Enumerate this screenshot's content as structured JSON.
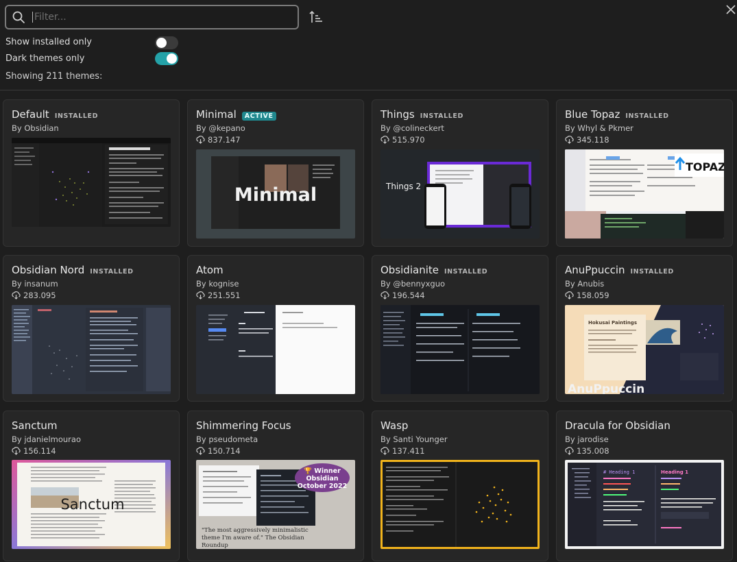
{
  "search": {
    "placeholder": "Filter..."
  },
  "settings": {
    "installed_only": {
      "label": "Show installed only",
      "on": false
    },
    "dark_only": {
      "label": "Dark themes only",
      "on": true
    }
  },
  "count_text": "Showing 211 themes:",
  "themes": [
    {
      "name": "Default",
      "badge": "INSTALLED",
      "author": "By Obsidian",
      "downloads": "",
      "preview_text": "",
      "preview_caption": ""
    },
    {
      "name": "Minimal",
      "badge": "ACTIVE",
      "author": "By @kepano",
      "downloads": "837.147",
      "preview_text": "Minimal",
      "preview_caption": ""
    },
    {
      "name": "Things",
      "badge": "INSTALLED",
      "author": "By @colineckert",
      "downloads": "515.970",
      "preview_text": "Things 2",
      "preview_caption": ""
    },
    {
      "name": "Blue Topaz",
      "badge": "INSTALLED",
      "author": "By Whyl & Pkmer",
      "downloads": "345.118",
      "preview_text": "TOPAZ",
      "preview_caption": ""
    },
    {
      "name": "Obsidian Nord",
      "badge": "INSTALLED",
      "author": "By insanum",
      "downloads": "283.095",
      "preview_text": "",
      "preview_caption": ""
    },
    {
      "name": "Atom",
      "badge": "",
      "author": "By kognise",
      "downloads": "251.551",
      "preview_text": "",
      "preview_caption": ""
    },
    {
      "name": "Obsidianite",
      "badge": "INSTALLED",
      "author": "By @bennyxguo",
      "downloads": "196.544",
      "preview_text": "",
      "preview_caption": ""
    },
    {
      "name": "AnuPpuccin",
      "badge": "INSTALLED",
      "author": "By Anubis",
      "downloads": "158.059",
      "preview_text": "AnuPpuccin",
      "preview_caption": "Hokusai Paintings"
    },
    {
      "name": "Sanctum",
      "badge": "",
      "author": "By jdanielmourao",
      "downloads": "156.114",
      "preview_text": "Sanctum",
      "preview_caption": ""
    },
    {
      "name": "Shimmering Focus",
      "badge": "",
      "author": "By pseudometa",
      "downloads": "150.714",
      "preview_text": "🏆 Winner Obsidian October 2022",
      "preview_caption": "\"The most aggressively minimalistic theme I'm aware of.\" The Obsidian Roundup"
    },
    {
      "name": "Wasp",
      "badge": "",
      "author": "By Santi Younger",
      "downloads": "137.411",
      "preview_text": "",
      "preview_caption": ""
    },
    {
      "name": "Dracula for Obsidian",
      "badge": "",
      "author": "By jarodise",
      "downloads": "135.008",
      "preview_text": "# Heading 1",
      "preview_caption": "Heading 1"
    }
  ],
  "colors": {
    "accent": "#24a2a8",
    "card_bg": "#262626",
    "page_bg": "#1e1e1e"
  },
  "icons": {
    "search": "search-icon",
    "sort": "sort-ascending-icon",
    "close": "close-icon",
    "download": "download-cloud-icon"
  }
}
